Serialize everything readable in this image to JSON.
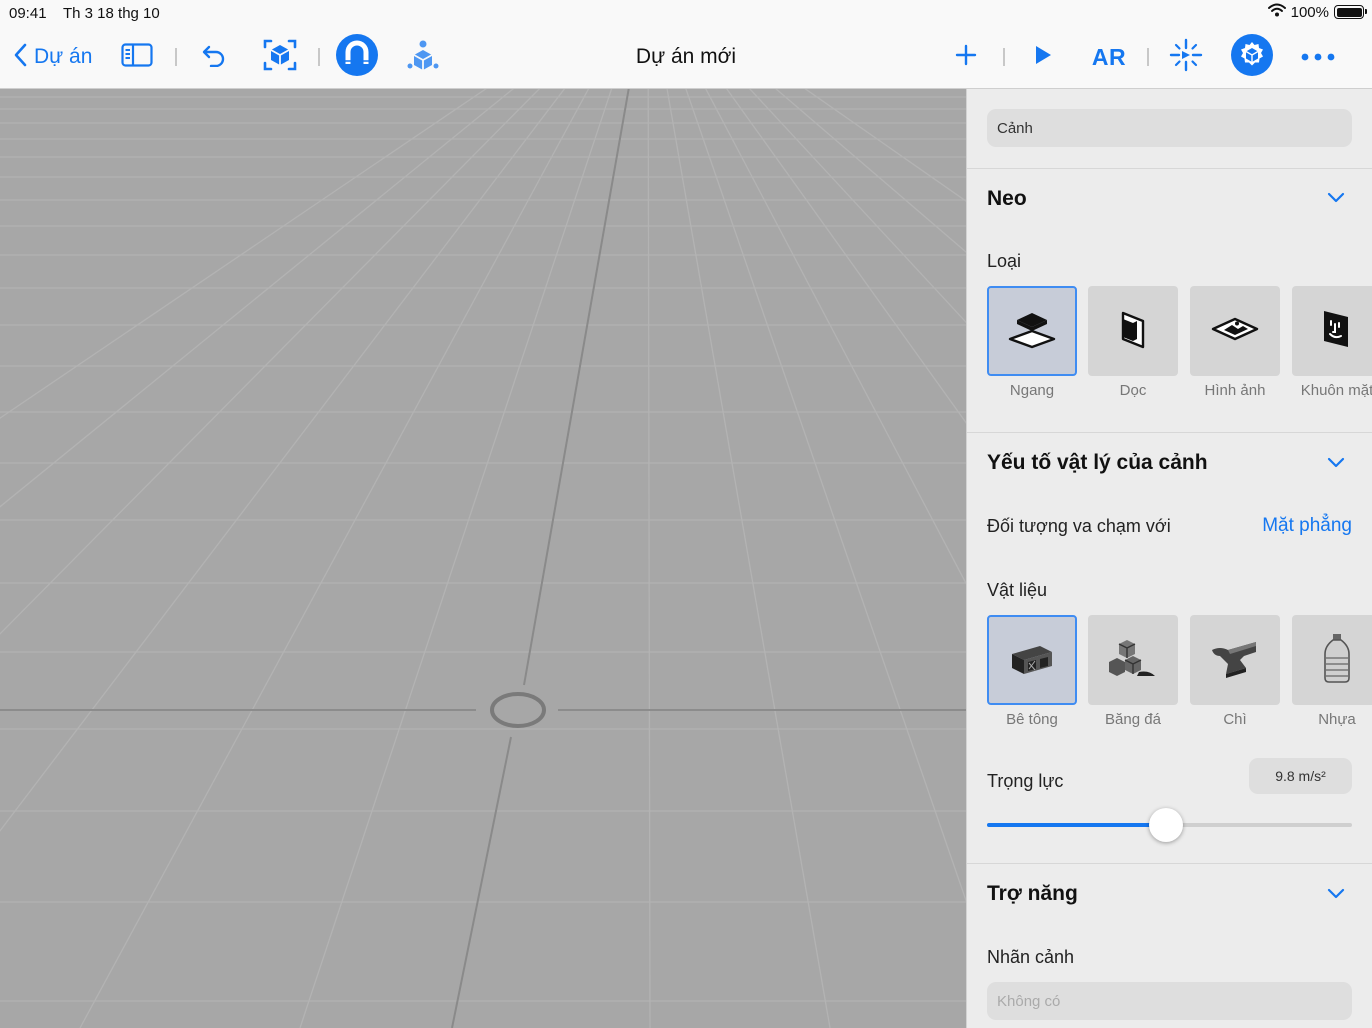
{
  "status": {
    "time": "09:41",
    "date": "Th 3 18 thg 10",
    "battery": "100%"
  },
  "toolbar": {
    "back_label": "Dự án",
    "title": "Dự án mới",
    "ar_label": "AR"
  },
  "icons": {
    "back": "chevron-left-icon",
    "sidebar": "sidebar-icon",
    "undo": "undo-icon",
    "scan": "scan-object-icon",
    "snap": "magnet-icon",
    "add-object": "object-library-icon",
    "add": "plus-icon",
    "play": "play-icon",
    "ar": "ar-icon",
    "anchor": "anchor-icon",
    "properties": "properties-gear-icon",
    "more": "ellipsis-icon"
  },
  "colors": {
    "accent": "#1577f0",
    "panel": "#ececec",
    "viewport": "#a7a7a7"
  },
  "inspector": {
    "scene_field": "Cảnh",
    "anchor": {
      "title": "Neo",
      "type_label": "Loại",
      "types": [
        {
          "label": "Ngang",
          "icon": "horizontal-plane-icon",
          "selected": true
        },
        {
          "label": "Dọc",
          "icon": "vertical-plane-icon",
          "selected": false
        },
        {
          "label": "Hình ảnh",
          "icon": "image-anchor-icon",
          "selected": false
        },
        {
          "label": "Khuôn mặt",
          "icon": "face-anchor-icon",
          "selected": false
        }
      ]
    },
    "physics": {
      "title": "Yếu tố vật lý của cảnh",
      "collide_label": "Đối tượng va chạm với",
      "collide_value": "Mặt phẳng",
      "material_label": "Vật liệu",
      "materials": [
        {
          "label": "Bê tông",
          "icon": "concrete-block-icon",
          "selected": true
        },
        {
          "label": "Băng đá",
          "icon": "ice-cubes-icon",
          "selected": false
        },
        {
          "label": "Chì",
          "icon": "anvil-icon",
          "selected": false
        },
        {
          "label": "Nhựa",
          "icon": "plastic-bottle-icon",
          "selected": false
        }
      ],
      "gravity_label": "Trọng lực",
      "gravity_value": "9.8 m/s²",
      "gravity_slider_fraction": 0.49
    },
    "accessibility": {
      "title": "Trợ năng",
      "scene_label": "Nhãn cảnh",
      "scene_placeholder": "Không có"
    }
  }
}
